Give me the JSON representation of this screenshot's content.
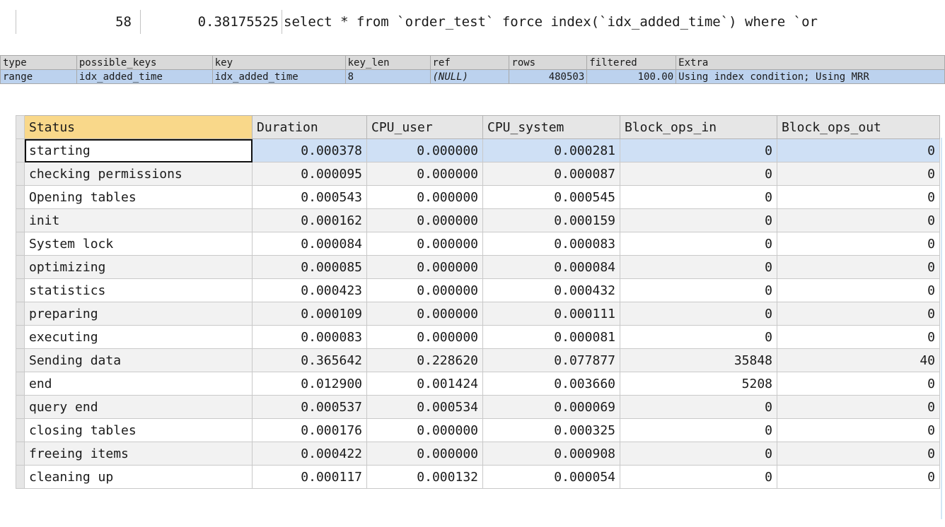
{
  "query": {
    "id": "58",
    "duration": "0.38175525",
    "sql": "select * from `order_test` force index(`idx_added_time`) where `or"
  },
  "explain": {
    "headers": [
      "type",
      "possible_keys",
      "key",
      "key_len",
      "ref",
      "rows",
      "filtered",
      "Extra"
    ],
    "row": {
      "type": "range",
      "possible_keys": "idx_added_time",
      "key": "idx_added_time",
      "key_len": "8",
      "ref": "(NULL)",
      "rows": "480503",
      "filtered": "100.00",
      "extra": "Using index condition; Using MRR"
    }
  },
  "profile": {
    "headers": [
      "Status",
      "Duration",
      "CPU_user",
      "CPU_system",
      "Block_ops_in",
      "Block_ops_out"
    ],
    "rows": [
      [
        "starting",
        "0.000378",
        "0.000000",
        "0.000281",
        "0",
        "0"
      ],
      [
        "checking permissions",
        "0.000095",
        "0.000000",
        "0.000087",
        "0",
        "0"
      ],
      [
        "Opening tables",
        "0.000543",
        "0.000000",
        "0.000545",
        "0",
        "0"
      ],
      [
        "init",
        "0.000162",
        "0.000000",
        "0.000159",
        "0",
        "0"
      ],
      [
        "System lock",
        "0.000084",
        "0.000000",
        "0.000083",
        "0",
        "0"
      ],
      [
        "optimizing",
        "0.000085",
        "0.000000",
        "0.000084",
        "0",
        "0"
      ],
      [
        "statistics",
        "0.000423",
        "0.000000",
        "0.000432",
        "0",
        "0"
      ],
      [
        "preparing",
        "0.000109",
        "0.000000",
        "0.000111",
        "0",
        "0"
      ],
      [
        "executing",
        "0.000083",
        "0.000000",
        "0.000081",
        "0",
        "0"
      ],
      [
        "Sending data",
        "0.365642",
        "0.228620",
        "0.077877",
        "35848",
        "40"
      ],
      [
        "end",
        "0.012900",
        "0.001424",
        "0.003660",
        "5208",
        "0"
      ],
      [
        "query end",
        "0.000537",
        "0.000534",
        "0.000069",
        "0",
        "0"
      ],
      [
        "closing tables",
        "0.000176",
        "0.000000",
        "0.000325",
        "0",
        "0"
      ],
      [
        "freeing items",
        "0.000422",
        "0.000000",
        "0.000908",
        "0",
        "0"
      ],
      [
        "cleaning up",
        "0.000117",
        "0.000132",
        "0.000054",
        "0",
        "0"
      ]
    ]
  }
}
